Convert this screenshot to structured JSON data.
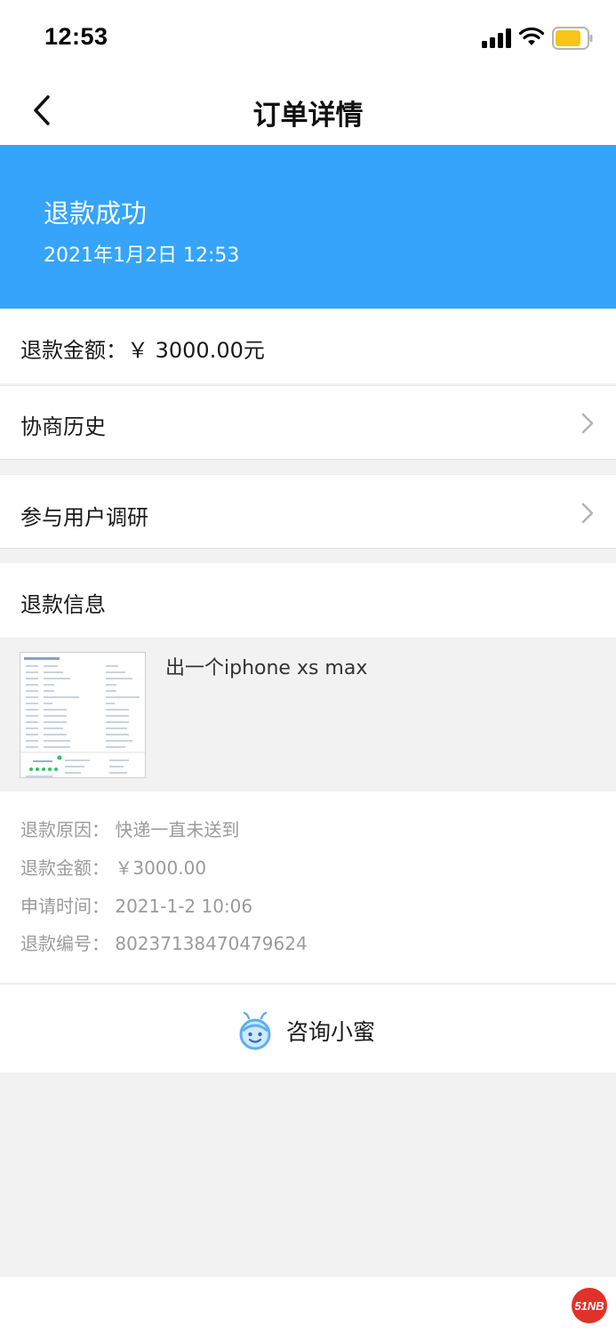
{
  "status_bar": {
    "time": "12:53",
    "icons": [
      "signal-icon",
      "wifi-icon",
      "battery-icon"
    ],
    "battery_color": "#f5c518"
  },
  "nav": {
    "back_icon": "chevron-left-icon",
    "title": "订单详情"
  },
  "banner": {
    "status": "退款成功",
    "time": "2021年1月2日 12:53",
    "color": "#35a4fa"
  },
  "amount_row": {
    "label": "退款金额：￥ 3000.00元"
  },
  "history_row": {
    "label": "协商历史",
    "icon": "chevron-right-icon"
  },
  "survey_row": {
    "label": "参与用户调研",
    "icon": "chevron-right-icon"
  },
  "refund_info": {
    "header": "退款信息",
    "product_title": "出一个iphone xs max",
    "details": [
      "退款原因：  快递一直未送到",
      "退款金额：  ￥3000.00",
      "申请时间：  2021-1-2 10:06",
      "退款编号：  80237138470479624"
    ]
  },
  "consult": {
    "icon": "bee-mascot-icon",
    "label": "咨询小蜜"
  },
  "watermark": {
    "text": "51NB"
  }
}
